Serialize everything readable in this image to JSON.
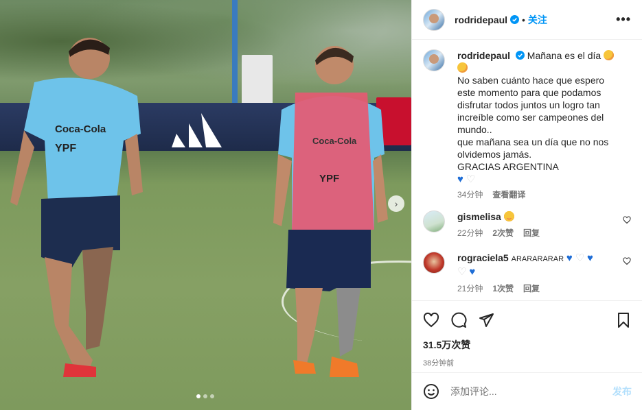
{
  "post": {
    "author": "rodridepaul",
    "follow_label": "关注",
    "more_label": "•••",
    "caption_line1": "Mañana es el día",
    "caption_rest": "No saben cuánto hace que espero\neste momento para que podamos\ndisfrutar todos juntos un logro tan\nincreíble como ser campeones del\nmundo..\nque mañana sea un día que no nos\nolvidemos jamás.\nGRACIAS ARGENTINA",
    "caption_time": "34分钟",
    "translate_label": "查看翻译",
    "likes": "31.5万次赞",
    "posted": "38分钟前",
    "carousel": {
      "slides": 3,
      "active": 1
    }
  },
  "comments": [
    {
      "user": "gismelisa",
      "text": "",
      "time": "22分钟",
      "likes": "2次赞",
      "reply": "回复"
    },
    {
      "user": "rograciela5",
      "text": "ARARARARAR",
      "time": "21分钟",
      "likes": "1次赞",
      "reply": "回复"
    }
  ],
  "composer": {
    "placeholder": "添加评论...",
    "post_label": "发布"
  },
  "icons": {
    "verified": "verified-badge-icon",
    "more": "more-options-icon",
    "like": "heart-icon",
    "comment": "comment-icon",
    "share": "share-icon",
    "save": "bookmark-icon",
    "emoji": "emoji-icon",
    "next": "chevron-right-icon"
  },
  "colors": {
    "accent": "#0095f6",
    "post_disabled": "#b2dffc",
    "muted": "#737373"
  }
}
